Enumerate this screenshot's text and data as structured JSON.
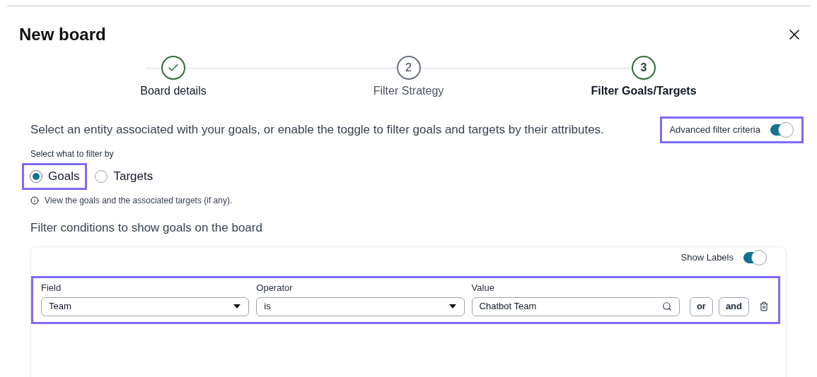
{
  "dialog": {
    "title": "New board"
  },
  "steps": [
    {
      "label": "Board details",
      "completed": true,
      "selected": false
    },
    {
      "number": "2",
      "label": "Filter Strategy",
      "completed": false,
      "selected": false
    },
    {
      "number": "3",
      "label": "Filter Goals/Targets",
      "completed": false,
      "selected": true
    }
  ],
  "description": "Select an entity associated with your goals, or enable the toggle to filter goals and targets by their attributes.",
  "advanced_toggle": {
    "label": "Advanced filter criteria",
    "on": true
  },
  "filter_by": {
    "label": "Select what to filter by",
    "options": [
      {
        "label": "Goals",
        "selected": true
      },
      {
        "label": "Targets",
        "selected": false
      }
    ],
    "hint": "View the goals and the associated targets (if any)."
  },
  "conditions": {
    "heading": "Filter conditions to show goals on the board",
    "show_labels": {
      "label": "Show Labels",
      "on": true
    },
    "row": {
      "field": {
        "label": "Field",
        "value": "Team"
      },
      "operator": {
        "label": "Operator",
        "value": "is"
      },
      "value": {
        "label": "Value",
        "value": "Chatbot Team"
      },
      "buttons": [
        "or",
        "and"
      ]
    }
  }
}
